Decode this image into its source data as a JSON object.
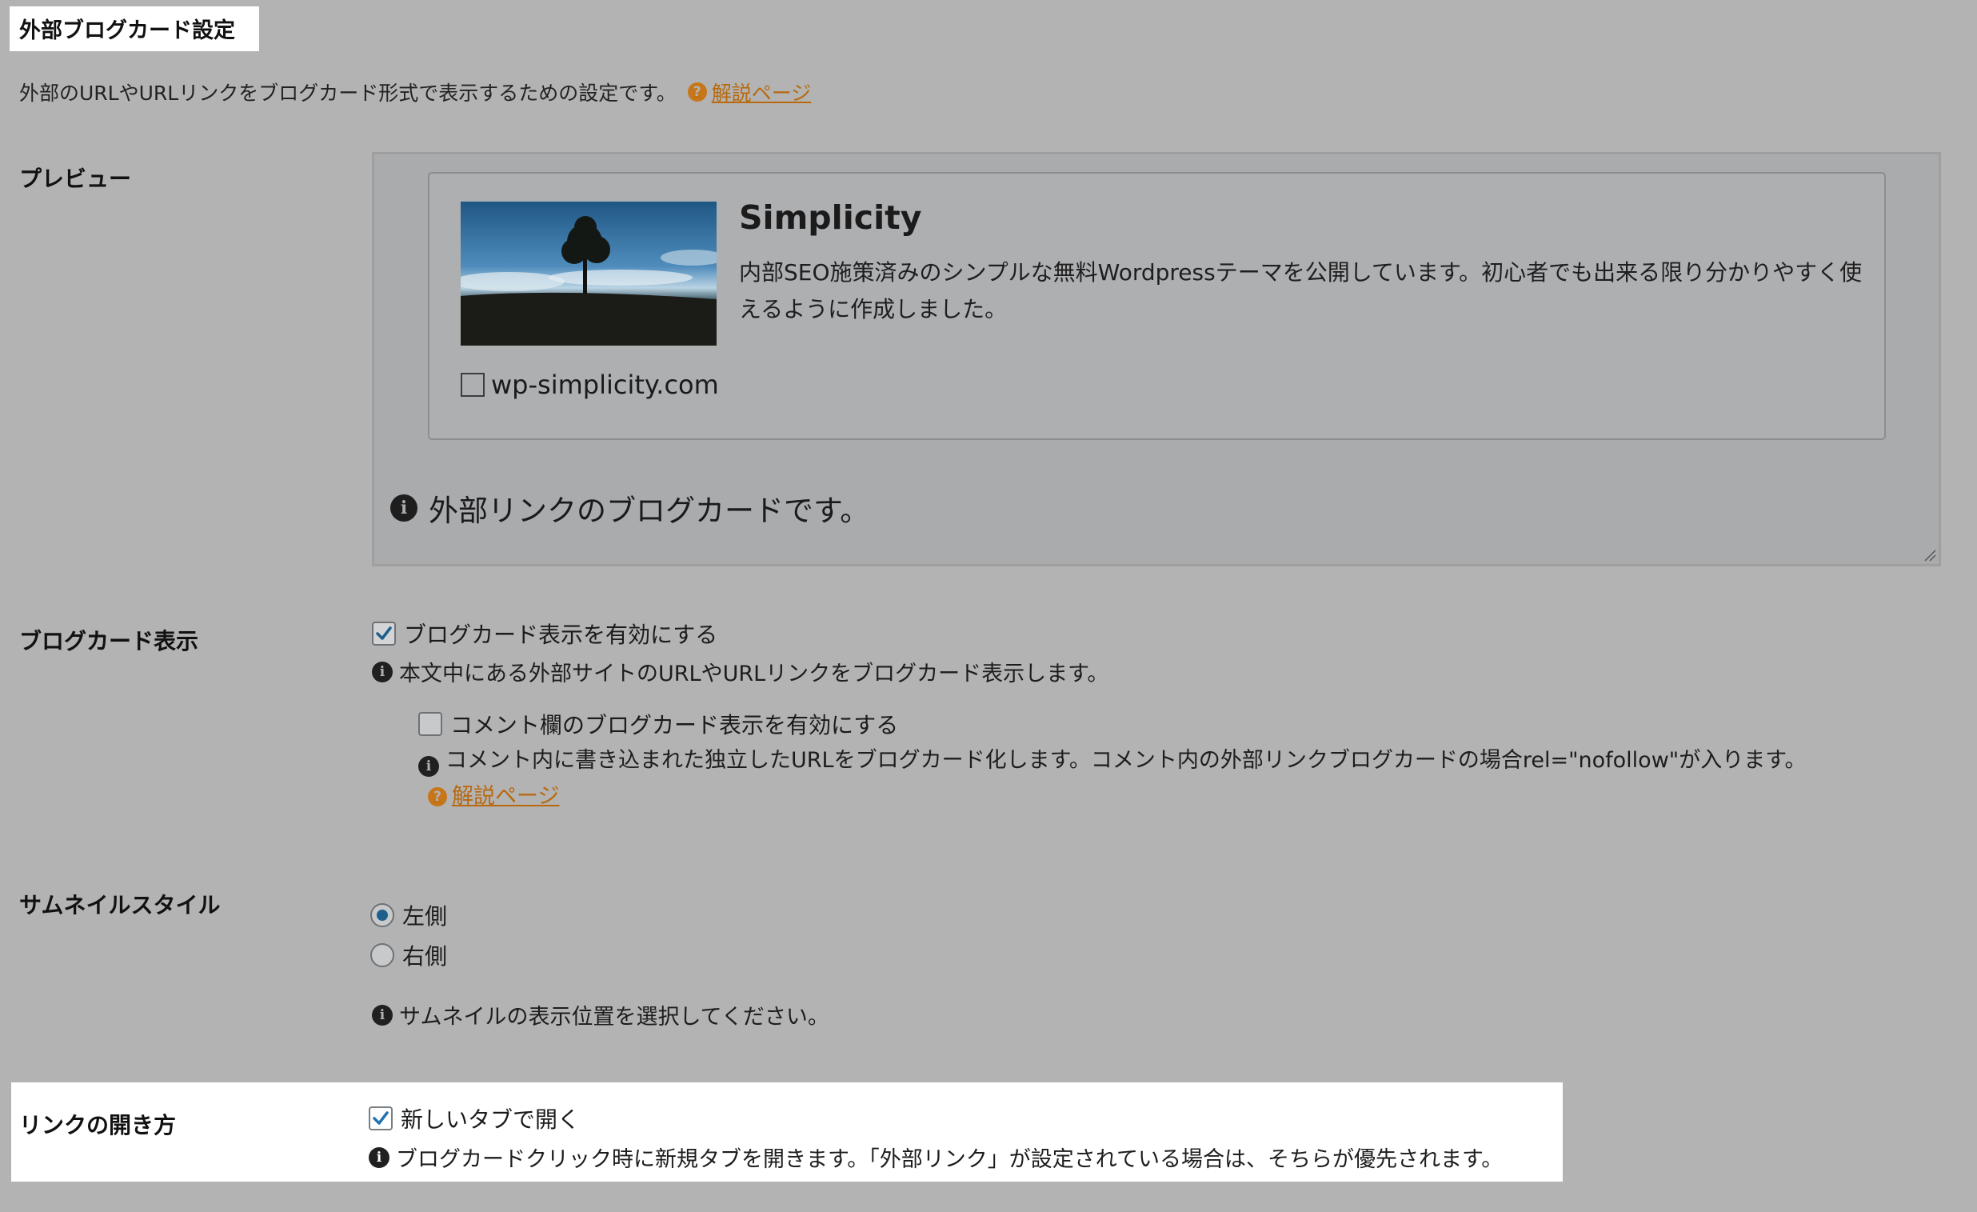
{
  "section": {
    "title": "外部ブログカード設定",
    "description": "外部のURLやURLリンクをブログカード形式で表示するための設定です。",
    "help_link": "解説ページ"
  },
  "preview": {
    "label": "プレビュー",
    "card_title": "Simplicity",
    "card_description": "内部SEO施策済みのシンプルな無料Wordpressテーマを公開しています。初心者でも出来る限り分かりやすく使えるように作成しました。",
    "card_domain": "wp-simplicity.com",
    "note": "外部リンクのブログカードです。"
  },
  "blogcard_display": {
    "label": "ブログカード表示",
    "enable_label": "ブログカード表示を有効にする",
    "enable_checked": true,
    "enable_note": "本文中にある外部サイトのURLやURLリンクをブログカード表示します。",
    "comment_label": "コメント欄のブログカード表示を有効にする",
    "comment_checked": false,
    "comment_note": "コメント内に書き込まれた独立したURLをブログカード化します。コメント内の外部リンクブログカードの場合rel=\"nofollow\"が入ります。",
    "comment_help_link": "解説ページ"
  },
  "thumbnail_style": {
    "label": "サムネイルスタイル",
    "options": [
      "左側",
      "右側"
    ],
    "selected": "左側",
    "note": "サムネイルの表示位置を選択してください。"
  },
  "link_open": {
    "label": "リンクの開き方",
    "option_label": "新しいタブで開く",
    "checked": true,
    "note": "ブログカードクリック時に新規タブを開きます。「外部リンク」が設定されている場合は、そちらが優先されます。"
  },
  "colors": {
    "background": "#b3b3b3",
    "highlight": "#ffffff",
    "link": "#b8690e",
    "radio_selected": "#1d5f8a"
  }
}
